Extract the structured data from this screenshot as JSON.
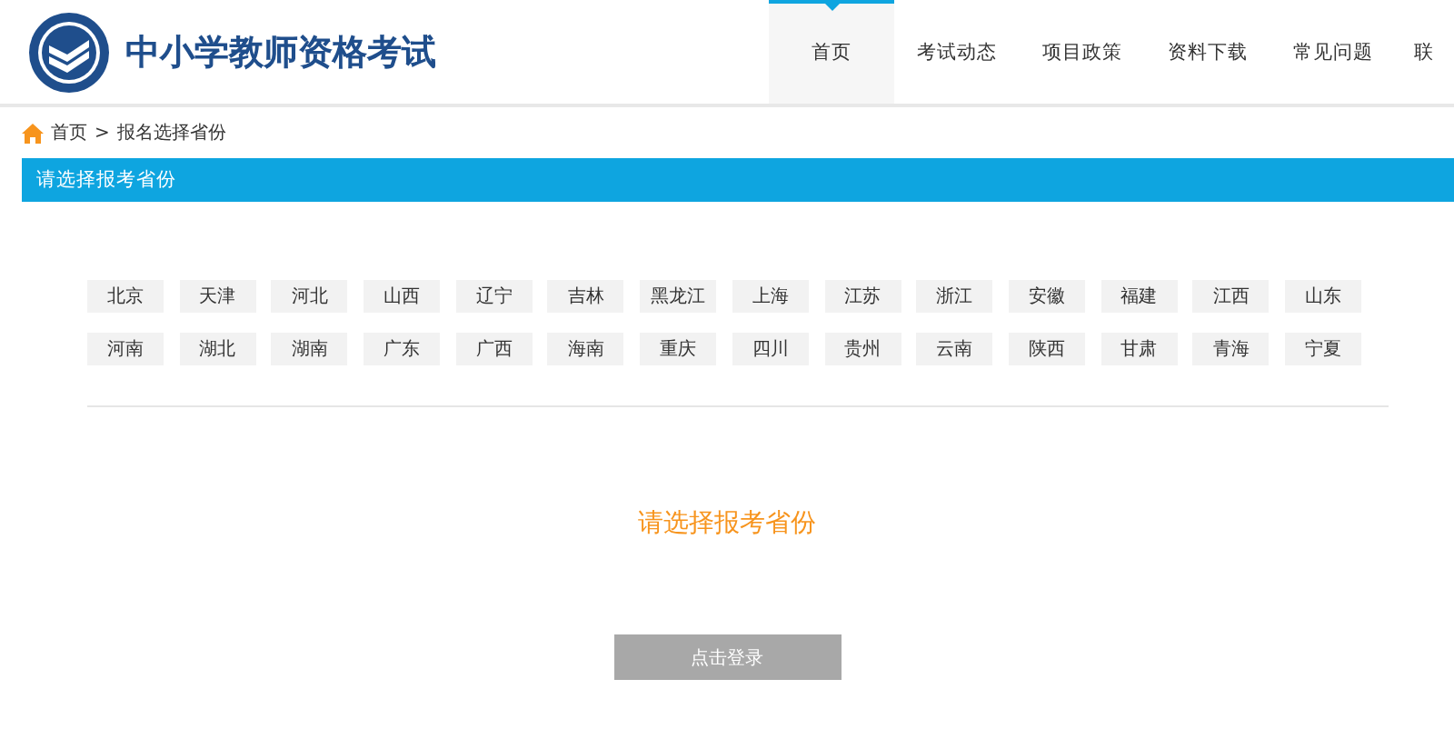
{
  "header": {
    "site_title": "中小学教师资格考试"
  },
  "nav": [
    {
      "label": "首页",
      "selected": true
    },
    {
      "label": "考试动态",
      "selected": false
    },
    {
      "label": "项目政策",
      "selected": false
    },
    {
      "label": "资料下载",
      "selected": false
    },
    {
      "label": "常见问题",
      "selected": false
    },
    {
      "label": "联",
      "selected": false
    }
  ],
  "breadcrumb": [
    "首页",
    "报名选择省份"
  ],
  "breadcrumb_separator": ">",
  "section_title": "请选择报考省份",
  "provinces": [
    "北京",
    "天津",
    "河北",
    "山西",
    "辽宁",
    "吉林",
    "黑龙江",
    "上海",
    "江苏",
    "浙江",
    "安徽",
    "福建",
    "江西",
    "山东",
    "河南",
    "湖北",
    "湖南",
    "广东",
    "广西",
    "海南",
    "重庆",
    "四川",
    "贵州",
    "云南",
    "陕西",
    "甘肃",
    "青海",
    "宁夏"
  ],
  "prompt": "请选择报考省份",
  "login_button": {
    "label": "点击登录",
    "disabled": true
  }
}
